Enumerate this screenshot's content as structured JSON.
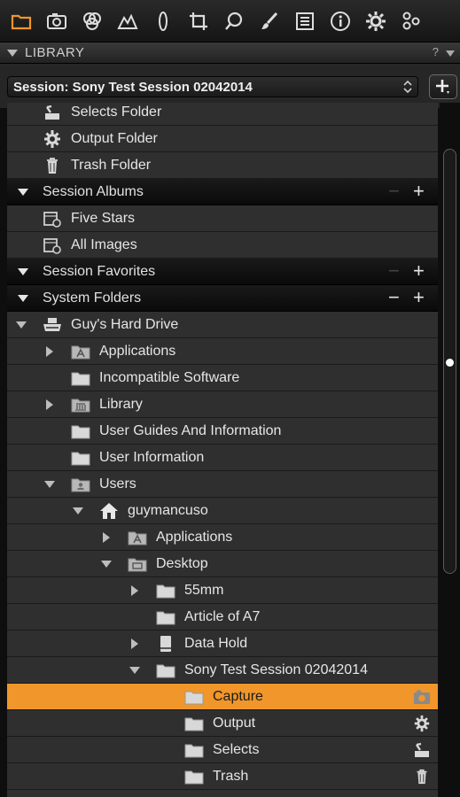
{
  "toolbar": {
    "tools": [
      {
        "icon": "library-folder-icon",
        "active": true
      },
      {
        "icon": "camera-icon"
      },
      {
        "icon": "color-circles-icon"
      },
      {
        "icon": "exposure-icon"
      },
      {
        "icon": "lens-icon"
      },
      {
        "icon": "crop-icon"
      },
      {
        "icon": "focus-icon"
      },
      {
        "icon": "brush-icon"
      },
      {
        "icon": "metadata-icon"
      },
      {
        "icon": "info-icon"
      },
      {
        "icon": "settings-gear-icon"
      },
      {
        "icon": "batch-icon"
      }
    ],
    "accent": "#f0962a"
  },
  "library": {
    "title": "LIBRARY",
    "help": "?"
  },
  "session": {
    "selected": "Session: Sony Test Session 02042014",
    "add_label": "+"
  },
  "tree": {
    "rows": [
      {
        "label": "Selects Folder",
        "icon": "selects-folder-icon"
      },
      {
        "label": "Output Folder",
        "icon": "gear-icon"
      },
      {
        "label": "Trash Folder",
        "icon": "trash-icon"
      },
      {
        "label": "Session Albums",
        "section": true
      },
      {
        "label": "Five Stars",
        "icon": "smart-album-icon"
      },
      {
        "label": "All Images",
        "icon": "smart-album-icon"
      },
      {
        "label": "Session Favorites",
        "section": true
      },
      {
        "label": "System Folders",
        "section": true
      },
      {
        "label": "Guy's Hard Drive",
        "icon": "hard-drive-icon",
        "expanded": true
      },
      {
        "label": "Applications",
        "icon": "applications-folder-icon",
        "collapsed": true
      },
      {
        "label": "Incompatible Software",
        "icon": "folder-icon"
      },
      {
        "label": "Library",
        "icon": "library-folder-icon",
        "collapsed": true
      },
      {
        "label": "User Guides And Information",
        "icon": "folder-icon"
      },
      {
        "label": "User Information",
        "icon": "folder-icon"
      },
      {
        "label": "Users",
        "icon": "users-folder-icon",
        "expanded": true
      },
      {
        "label": "guymancuso",
        "icon": "home-icon",
        "expanded": true
      },
      {
        "label": "Applications",
        "icon": "applications-folder-icon",
        "collapsed": true
      },
      {
        "label": "Desktop",
        "icon": "desktop-folder-icon",
        "expanded": true
      },
      {
        "label": "55mm",
        "icon": "folder-icon",
        "collapsed": true
      },
      {
        "label": "Article of A7",
        "icon": "folder-icon"
      },
      {
        "label": "Data Hold",
        "icon": "drive-icon",
        "collapsed": true
      },
      {
        "label": "Sony Test Session 02042014",
        "icon": "folder-icon",
        "expanded": true
      },
      {
        "label": "Capture",
        "icon": "folder-icon",
        "selected": true,
        "right_icon": "camera-icon"
      },
      {
        "label": "Output",
        "icon": "folder-icon",
        "right_icon": "gear-icon"
      },
      {
        "label": "Selects",
        "icon": "folder-icon",
        "right_icon": "selects-icon"
      },
      {
        "label": "Trash",
        "icon": "folder-icon",
        "right_icon": "trash-icon"
      }
    ]
  }
}
